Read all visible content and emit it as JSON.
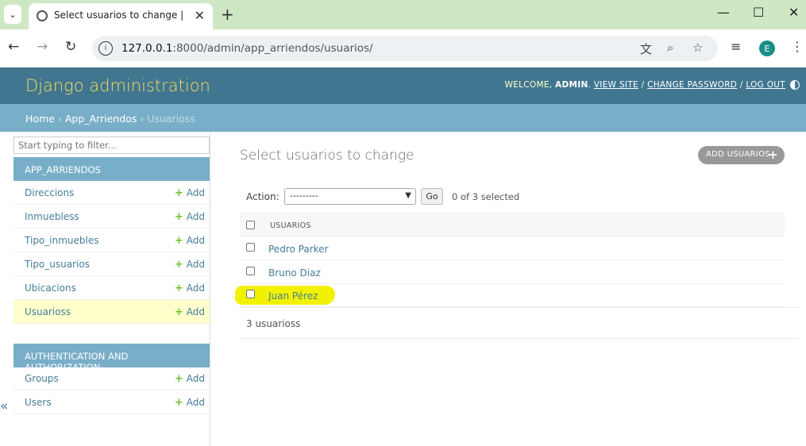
{
  "browser": {
    "tab_title": "Select usuarios to change | Django site admin",
    "new_tab": "+",
    "url_host": "127.0.0.1",
    "url_rest": ":8000/admin/app_arriendos/usuarios/",
    "profile_initial": "E"
  },
  "header": {
    "branding": "Django administration",
    "welcome": "WELCOME, ",
    "username": "ADMIN",
    "view_site": "VIEW SITE",
    "change_password": "CHANGE PASSWORD",
    "log_out": "LOG OUT",
    "sep": " / "
  },
  "breadcrumbs": {
    "home": "Home",
    "app": "App_Arriendos",
    "current": "Usuarioss",
    "sep": " › "
  },
  "sidebar": {
    "filter_placeholder": "Start typing to filter...",
    "app1": {
      "caption": "APP_ARRIENDOS",
      "models": [
        "Direccions",
        "Inmuebless",
        "Tipo_inmuebles",
        "Tipo_usuarios",
        "Ubicacions",
        "Usuarioss"
      ]
    },
    "app2": {
      "caption": "AUTHENTICATION AND AUTHORIZATION",
      "models": [
        "Groups",
        "Users"
      ]
    },
    "add_label": "Add",
    "collapse": "«"
  },
  "content": {
    "title": "Select usuarios to change",
    "add_button": "ADD USUARIOS",
    "action_label": "Action:",
    "action_selected": "---------",
    "go_button": "Go",
    "action_counter": "0 of 3 selected",
    "column_header": "USUARIOS",
    "rows": [
      "Pedro Parker",
      "Bruno Diaz",
      "Juan Pérez"
    ],
    "paginator": "3 usuarioss"
  },
  "colors": {
    "header_bg": "#417690",
    "branding": "#f5dd5d",
    "breadcrumbs_bg": "#79aec8",
    "link": "#447e9b",
    "add_plus": "#70bf2b",
    "highlight": "#f2f200"
  }
}
